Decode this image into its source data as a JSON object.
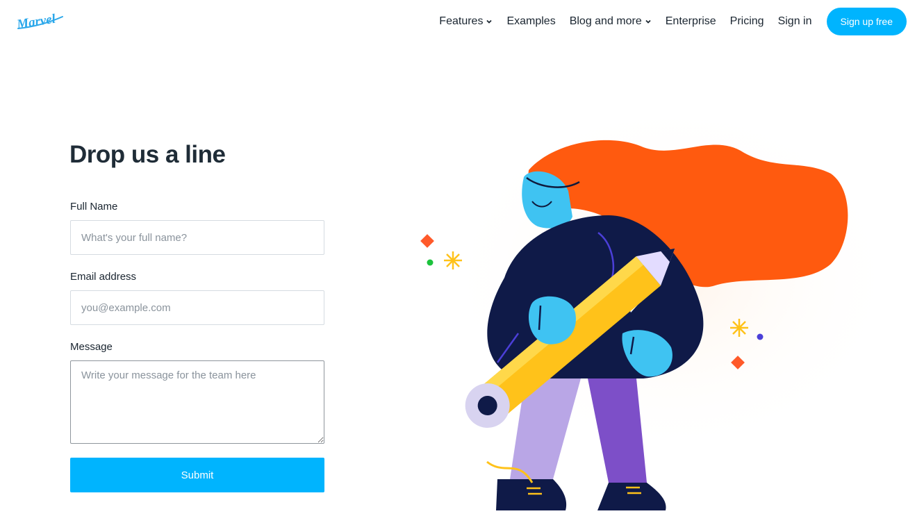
{
  "brand": {
    "logo_text": "Marvel",
    "accent": "#00b4fe"
  },
  "nav": {
    "items": [
      {
        "label": "Features",
        "dropdown": true
      },
      {
        "label": "Examples",
        "dropdown": false
      },
      {
        "label": "Blog and more",
        "dropdown": true
      },
      {
        "label": "Enterprise",
        "dropdown": false
      },
      {
        "label": "Pricing",
        "dropdown": false
      },
      {
        "label": "Sign in",
        "dropdown": false
      }
    ],
    "cta": "Sign up free"
  },
  "form": {
    "title": "Drop us a line",
    "full_name": {
      "label": "Full Name",
      "placeholder": "What's your full name?",
      "value": ""
    },
    "email": {
      "label": "Email address",
      "placeholder": "you@example.com",
      "value": ""
    },
    "message": {
      "label": "Message",
      "placeholder": "Write your message for the team here",
      "value": ""
    },
    "submit": "Submit"
  }
}
